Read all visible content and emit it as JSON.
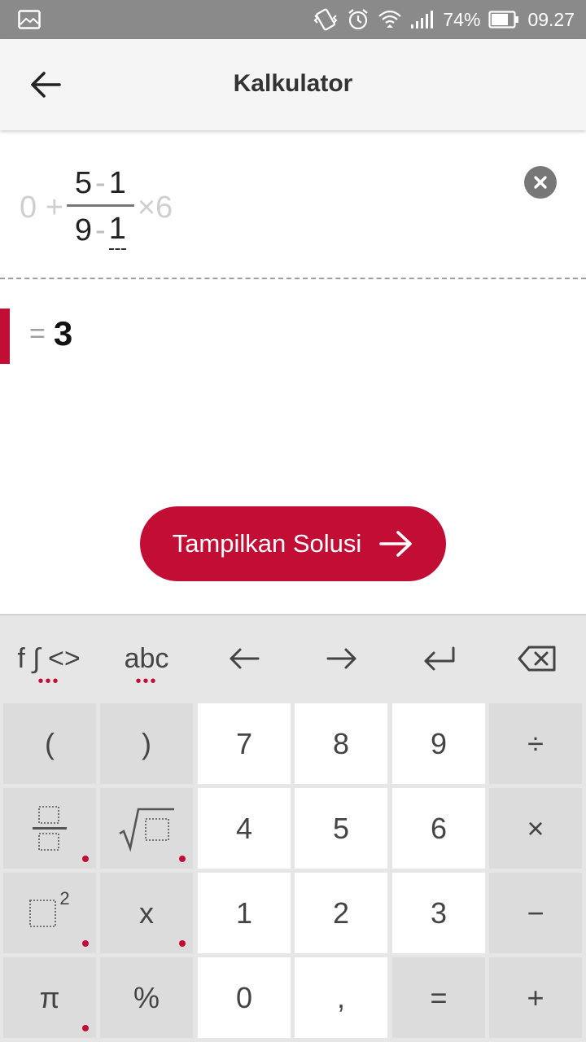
{
  "status_bar": {
    "battery": "74%",
    "time": "09.27"
  },
  "header": {
    "title": "Kalkulator"
  },
  "expression": {
    "leading_ghost": "0 +",
    "numerator": [
      "5",
      "-",
      "1"
    ],
    "denominator": [
      "9",
      "-",
      "1"
    ],
    "trailing_ghost": "×6"
  },
  "result": {
    "equals": "=",
    "value": "3"
  },
  "solve_button": {
    "label": "Tampilkan Solusi"
  },
  "keyboard": {
    "top_row": {
      "functions": "f ∫ <>",
      "letters": "abc",
      "dots": "•••"
    },
    "keys": {
      "open_paren": "(",
      "close_paren": ")",
      "seven": "7",
      "eight": "8",
      "nine": "9",
      "divide": "÷",
      "four": "4",
      "five": "5",
      "six": "6",
      "multiply": "×",
      "x": "x",
      "one": "1",
      "two": "2",
      "three": "3",
      "minus": "−",
      "pi": "π",
      "percent": "%",
      "zero": "0",
      "comma": ",",
      "equals": "=",
      "plus": "+",
      "square_exp": "2"
    }
  },
  "colors": {
    "accent": "#c20e35",
    "status_bar": "#8a8a8a",
    "key_grey": "#dcdcdc",
    "key_white": "#ffffff"
  }
}
